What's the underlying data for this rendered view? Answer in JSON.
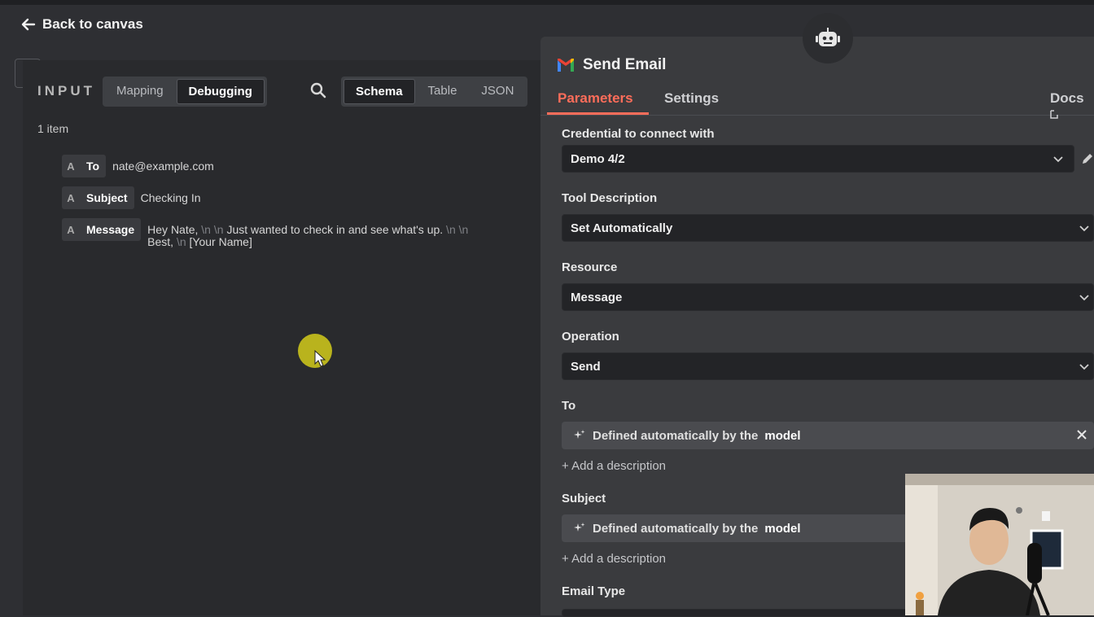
{
  "nav": {
    "back_label": "Back to canvas"
  },
  "input_panel": {
    "title": "INPUT",
    "mode_tabs": [
      "Mapping",
      "Debugging"
    ],
    "active_mode": "Debugging",
    "view_tabs": [
      "Schema",
      "Table",
      "JSON"
    ],
    "active_view": "Schema",
    "item_count": "1 item",
    "fields": [
      {
        "type": "A",
        "key": "To",
        "value": "nate@example.com"
      },
      {
        "type": "A",
        "key": "Subject",
        "value": "Checking In"
      },
      {
        "type": "A",
        "key": "Message",
        "value_parts": [
          "Hey Nate,",
          " \\n \\n ",
          "Just wanted to check in and see what's up.",
          " \\n \\n ",
          "Best,",
          " \\n ",
          "[Your Name]"
        ]
      }
    ]
  },
  "node": {
    "title": "Send Email",
    "tabs": [
      "Parameters",
      "Settings"
    ],
    "active_tab": "Parameters",
    "docs_label": "Docs",
    "credential_label": "Credential to connect with",
    "credential_value": "Demo 4/2",
    "tool_description_label": "Tool Description",
    "tool_description_value": "Set Automatically",
    "resource_label": "Resource",
    "resource_value": "Message",
    "operation_label": "Operation",
    "operation_value": "Send",
    "to_label": "To",
    "auto_prefix": "Defined automatically by the",
    "auto_bold": "model",
    "add_description": "+ Add a description",
    "subject_label": "Subject",
    "email_type_label": "Email Type"
  },
  "colors": {
    "accent": "#ff6d5a",
    "cursor_highlight": "#c9c21c",
    "panel_bg": "#3a3b3e",
    "input_bg": "#292a2d"
  },
  "icons": [
    "back-arrow-icon",
    "search-icon",
    "robot-icon",
    "gmail-icon",
    "chevron-down-icon",
    "pencil-icon",
    "sparkle-icon",
    "close-icon",
    "external-link-icon"
  ]
}
